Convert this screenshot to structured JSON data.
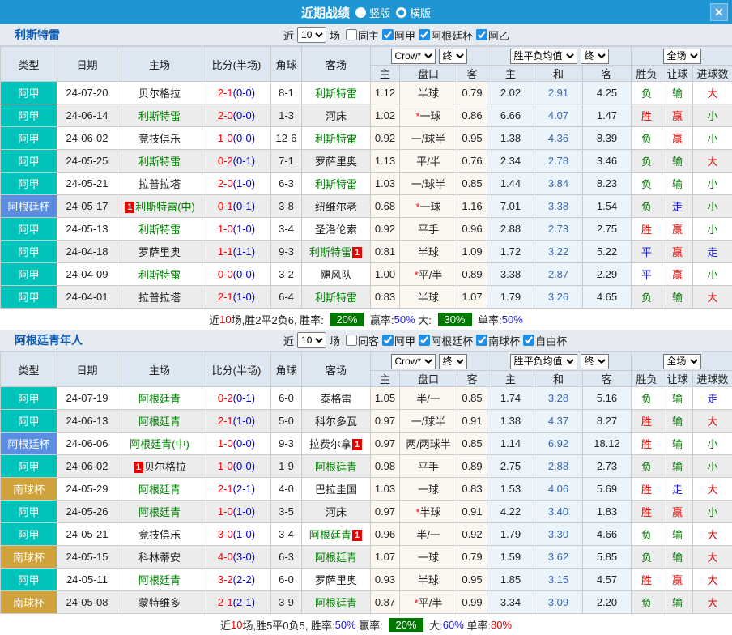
{
  "titlebar": {
    "title": "近期战绩",
    "layout_options": [
      {
        "label": "竖版",
        "selected": true
      },
      {
        "label": "横版",
        "selected": false
      }
    ],
    "close_label": "✕"
  },
  "colors": {
    "league": {
      "阿甲": "#00c3b9",
      "阿根廷杯": "#5b8de0",
      "南球杯": "#cfa23c"
    },
    "result": {
      "胜": "#e60000",
      "平": "#1a1ae6",
      "负": "#007a00",
      "赢": "#e60000",
      "输": "#007a00",
      "走": "#1a1ae6",
      "大": "#e60000",
      "小": "#007a00"
    },
    "titlebar_blue": "#1f96d3",
    "team_green": "#008000",
    "score_main_red": "#ff0000",
    "score_half_blue": "#0000dd",
    "summary_badge_green": "#007800"
  },
  "table": {
    "filter_prefix": "近",
    "filter_suffix": "场",
    "select_value": "10",
    "columns_left": [
      "类型",
      "日期",
      "主场",
      "比分(半场)",
      "角球",
      "客场"
    ],
    "odds_group": {
      "select1": "Crow*",
      "select2": "终",
      "cols": [
        "主",
        "盘口",
        "客"
      ]
    },
    "avg_group": {
      "select1": "胜平负均值",
      "select2": "终",
      "cols": [
        "主",
        "和",
        "客"
      ]
    },
    "scope_group": {
      "select": "全场",
      "cols": [
        "胜负",
        "让球",
        "进球数"
      ]
    }
  },
  "sections": [
    {
      "team": "利斯特雷",
      "same_label": "同主",
      "same_checked": false,
      "league_filters": [
        "阿甲",
        "阿根廷杯",
        "阿乙"
      ],
      "rows": [
        {
          "league": "阿甲",
          "date": "24-07-20",
          "home": {
            "name": "贝尔格拉",
            "green": false,
            "badge": null
          },
          "score": "2-1",
          "half": "(0-0)",
          "corners": "8-1",
          "away": {
            "name": "利斯特雷",
            "green": true,
            "badge": null
          },
          "odds": {
            "home": "1.12",
            "handicap": "半球",
            "star": false,
            "away": "0.79"
          },
          "avg": {
            "home": "2.02",
            "draw": "2.91",
            "away": "4.25"
          },
          "results": [
            "负",
            "输",
            "大"
          ]
        },
        {
          "league": "阿甲",
          "date": "24-06-14",
          "home": {
            "name": "利斯特雷",
            "green": true,
            "badge": null
          },
          "score": "2-0",
          "half": "(0-0)",
          "corners": "1-3",
          "away": {
            "name": "河床",
            "green": false,
            "badge": null
          },
          "odds": {
            "home": "1.02",
            "handicap": "一球",
            "star": true,
            "away": "0.86"
          },
          "avg": {
            "home": "6.66",
            "draw": "4.07",
            "away": "1.47"
          },
          "results": [
            "胜",
            "赢",
            "小"
          ]
        },
        {
          "league": "阿甲",
          "date": "24-06-02",
          "home": {
            "name": "竞技俱乐",
            "green": false,
            "badge": null
          },
          "score": "1-0",
          "half": "(0-0)",
          "corners": "12-6",
          "away": {
            "name": "利斯特雷",
            "green": true,
            "badge": null
          },
          "odds": {
            "home": "0.92",
            "handicap": "一/球半",
            "star": false,
            "away": "0.95"
          },
          "avg": {
            "home": "1.38",
            "draw": "4.36",
            "away": "8.39"
          },
          "results": [
            "负",
            "赢",
            "小"
          ]
        },
        {
          "league": "阿甲",
          "date": "24-05-25",
          "home": {
            "name": "利斯特雷",
            "green": true,
            "badge": null
          },
          "score": "0-2",
          "half": "(0-1)",
          "corners": "7-1",
          "away": {
            "name": "罗萨里奥",
            "green": false,
            "badge": null
          },
          "odds": {
            "home": "1.13",
            "handicap": "平/半",
            "star": false,
            "away": "0.76"
          },
          "avg": {
            "home": "2.34",
            "draw": "2.78",
            "away": "3.46"
          },
          "results": [
            "负",
            "输",
            "大"
          ]
        },
        {
          "league": "阿甲",
          "date": "24-05-21",
          "home": {
            "name": "拉普拉塔",
            "green": false,
            "badge": null
          },
          "score": "2-0",
          "half": "(1-0)",
          "corners": "6-3",
          "away": {
            "name": "利斯特雷",
            "green": true,
            "badge": null
          },
          "odds": {
            "home": "1.03",
            "handicap": "一/球半",
            "star": false,
            "away": "0.85"
          },
          "avg": {
            "home": "1.44",
            "draw": "3.84",
            "away": "8.23"
          },
          "results": [
            "负",
            "输",
            "小"
          ]
        },
        {
          "league": "阿根廷杯",
          "date": "24-05-17",
          "home": {
            "name": "利斯特雷(中)",
            "green": true,
            "badge": "1",
            "badge_pos": "before"
          },
          "score": "0-1",
          "half": "(0-1)",
          "corners": "3-8",
          "away": {
            "name": "纽维尔老",
            "green": false,
            "badge": null
          },
          "odds": {
            "home": "0.68",
            "handicap": "一球",
            "star": true,
            "away": "1.16"
          },
          "avg": {
            "home": "7.01",
            "draw": "3.38",
            "away": "1.54"
          },
          "results": [
            "负",
            "走",
            "小"
          ]
        },
        {
          "league": "阿甲",
          "date": "24-05-13",
          "home": {
            "name": "利斯特雷",
            "green": true,
            "badge": null
          },
          "score": "1-0",
          "half": "(1-0)",
          "corners": "3-4",
          "away": {
            "name": "圣洛伦索",
            "green": false,
            "badge": null
          },
          "odds": {
            "home": "0.92",
            "handicap": "平手",
            "star": false,
            "away": "0.96"
          },
          "avg": {
            "home": "2.88",
            "draw": "2.73",
            "away": "2.75"
          },
          "results": [
            "胜",
            "赢",
            "小"
          ]
        },
        {
          "league": "阿甲",
          "date": "24-04-18",
          "home": {
            "name": "罗萨里奥",
            "green": false,
            "badge": null
          },
          "score": "1-1",
          "half": "(1-1)",
          "corners": "9-3",
          "away": {
            "name": "利斯特雷",
            "green": true,
            "badge": "1",
            "badge_pos": "after"
          },
          "odds": {
            "home": "0.81",
            "handicap": "半球",
            "star": false,
            "away": "1.09"
          },
          "avg": {
            "home": "1.72",
            "draw": "3.22",
            "away": "5.22"
          },
          "results": [
            "平",
            "赢",
            "走"
          ]
        },
        {
          "league": "阿甲",
          "date": "24-04-09",
          "home": {
            "name": "利斯特雷",
            "green": true,
            "badge": null
          },
          "score": "0-0",
          "half": "(0-0)",
          "corners": "3-2",
          "away": {
            "name": "飓风队",
            "green": false,
            "badge": null
          },
          "odds": {
            "home": "1.00",
            "handicap": "平/半",
            "star": true,
            "away": "0.89"
          },
          "avg": {
            "home": "3.38",
            "draw": "2.87",
            "away": "2.29"
          },
          "results": [
            "平",
            "赢",
            "小"
          ]
        },
        {
          "league": "阿甲",
          "date": "24-04-01",
          "home": {
            "name": "拉普拉塔",
            "green": false,
            "badge": null
          },
          "score": "2-1",
          "half": "(1-0)",
          "corners": "6-4",
          "away": {
            "name": "利斯特雷",
            "green": true,
            "badge": null
          },
          "odds": {
            "home": "0.83",
            "handicap": "半球",
            "star": false,
            "away": "1.07"
          },
          "avg": {
            "home": "1.79",
            "draw": "3.26",
            "away": "4.65"
          },
          "results": [
            "负",
            "输",
            "大"
          ]
        }
      ],
      "summary": [
        {
          "text": "近",
          "style": "plain"
        },
        {
          "text": "10",
          "style": "red"
        },
        {
          "text": "场,胜2平2负6, 胜率: ",
          "style": "plain"
        },
        {
          "text": "20%",
          "style": "green-badge"
        },
        {
          "text": " 赢率:",
          "style": "plain"
        },
        {
          "text": "50%",
          "style": "blue"
        },
        {
          "text": " 大: ",
          "style": "plain"
        },
        {
          "text": "30%",
          "style": "green-badge"
        },
        {
          "text": " 单率:",
          "style": "plain"
        },
        {
          "text": "50%",
          "style": "blue"
        }
      ]
    },
    {
      "team": "阿根廷青年人",
      "same_label": "同客",
      "same_checked": false,
      "league_filters": [
        "阿甲",
        "阿根廷杯",
        "南球杯",
        "自由杯"
      ],
      "rows": [
        {
          "league": "阿甲",
          "date": "24-07-19",
          "home": {
            "name": "阿根廷青",
            "green": true,
            "badge": null
          },
          "score": "0-2",
          "half": "(0-1)",
          "corners": "6-0",
          "away": {
            "name": "泰格雷",
            "green": false,
            "badge": null
          },
          "odds": {
            "home": "1.05",
            "handicap": "半/一",
            "star": false,
            "away": "0.85"
          },
          "avg": {
            "home": "1.74",
            "draw": "3.28",
            "away": "5.16"
          },
          "results": [
            "负",
            "输",
            "走"
          ]
        },
        {
          "league": "阿甲",
          "date": "24-06-13",
          "home": {
            "name": "阿根廷青",
            "green": true,
            "badge": null
          },
          "score": "2-1",
          "half": "(1-0)",
          "corners": "5-0",
          "away": {
            "name": "科尔多瓦",
            "green": false,
            "badge": null
          },
          "odds": {
            "home": "0.97",
            "handicap": "一/球半",
            "star": false,
            "away": "0.91"
          },
          "avg": {
            "home": "1.38",
            "draw": "4.37",
            "away": "8.27"
          },
          "results": [
            "胜",
            "输",
            "大"
          ]
        },
        {
          "league": "阿根廷杯",
          "date": "24-06-06",
          "home": {
            "name": "阿根廷青(中)",
            "green": true,
            "badge": null
          },
          "score": "1-0",
          "half": "(0-0)",
          "corners": "9-3",
          "away": {
            "name": "拉费尔拿",
            "green": false,
            "badge": "1",
            "badge_pos": "after"
          },
          "odds": {
            "home": "0.97",
            "handicap": "两/两球半",
            "star": false,
            "away": "0.85"
          },
          "avg": {
            "home": "1.14",
            "draw": "6.92",
            "away": "18.12"
          },
          "results": [
            "胜",
            "输",
            "小"
          ]
        },
        {
          "league": "阿甲",
          "date": "24-06-02",
          "home": {
            "name": "贝尔格拉",
            "green": false,
            "badge": "1",
            "badge_pos": "before"
          },
          "score": "1-0",
          "half": "(0-0)",
          "corners": "1-9",
          "away": {
            "name": "阿根廷青",
            "green": true,
            "badge": null
          },
          "odds": {
            "home": "0.98",
            "handicap": "平手",
            "star": false,
            "away": "0.89"
          },
          "avg": {
            "home": "2.75",
            "draw": "2.88",
            "away": "2.73"
          },
          "results": [
            "负",
            "输",
            "小"
          ]
        },
        {
          "league": "南球杯",
          "date": "24-05-29",
          "home": {
            "name": "阿根廷青",
            "green": true,
            "badge": null
          },
          "score": "2-1",
          "half": "(2-1)",
          "corners": "4-0",
          "away": {
            "name": "巴拉圭国",
            "green": false,
            "badge": null
          },
          "odds": {
            "home": "1.03",
            "handicap": "一球",
            "star": false,
            "away": "0.83"
          },
          "avg": {
            "home": "1.53",
            "draw": "4.06",
            "away": "5.69"
          },
          "results": [
            "胜",
            "走",
            "大"
          ]
        },
        {
          "league": "阿甲",
          "date": "24-05-26",
          "home": {
            "name": "阿根廷青",
            "green": true,
            "badge": null
          },
          "score": "1-0",
          "half": "(1-0)",
          "corners": "3-5",
          "away": {
            "name": "河床",
            "green": false,
            "badge": null
          },
          "odds": {
            "home": "0.97",
            "handicap": "半球",
            "star": true,
            "away": "0.91"
          },
          "avg": {
            "home": "4.22",
            "draw": "3.40",
            "away": "1.83"
          },
          "results": [
            "胜",
            "赢",
            "小"
          ]
        },
        {
          "league": "阿甲",
          "date": "24-05-21",
          "home": {
            "name": "竞技俱乐",
            "green": false,
            "badge": null
          },
          "score": "3-0",
          "half": "(1-0)",
          "corners": "3-4",
          "away": {
            "name": "阿根廷青",
            "green": true,
            "badge": "1",
            "badge_pos": "after"
          },
          "odds": {
            "home": "0.96",
            "handicap": "半/一",
            "star": false,
            "away": "0.92"
          },
          "avg": {
            "home": "1.79",
            "draw": "3.30",
            "away": "4.66"
          },
          "results": [
            "负",
            "输",
            "大"
          ]
        },
        {
          "league": "南球杯",
          "date": "24-05-15",
          "home": {
            "name": "科林蒂安",
            "green": false,
            "badge": null
          },
          "score": "4-0",
          "half": "(3-0)",
          "corners": "6-3",
          "away": {
            "name": "阿根廷青",
            "green": true,
            "badge": null
          },
          "odds": {
            "home": "1.07",
            "handicap": "一球",
            "star": false,
            "away": "0.79"
          },
          "avg": {
            "home": "1.59",
            "draw": "3.62",
            "away": "5.85"
          },
          "results": [
            "负",
            "输",
            "大"
          ]
        },
        {
          "league": "阿甲",
          "date": "24-05-11",
          "home": {
            "name": "阿根廷青",
            "green": true,
            "badge": null
          },
          "score": "3-2",
          "half": "(2-2)",
          "corners": "6-0",
          "away": {
            "name": "罗萨里奥",
            "green": false,
            "badge": null
          },
          "odds": {
            "home": "0.93",
            "handicap": "半球",
            "star": false,
            "away": "0.95"
          },
          "avg": {
            "home": "1.85",
            "draw": "3.15",
            "away": "4.57"
          },
          "results": [
            "胜",
            "赢",
            "大"
          ]
        },
        {
          "league": "南球杯",
          "date": "24-05-08",
          "home": {
            "name": "蒙特维多",
            "green": false,
            "badge": null
          },
          "score": "2-1",
          "half": "(2-1)",
          "corners": "3-9",
          "away": {
            "name": "阿根廷青",
            "green": true,
            "badge": null
          },
          "odds": {
            "home": "0.87",
            "handicap": "平/半",
            "star": true,
            "away": "0.99"
          },
          "avg": {
            "home": "3.34",
            "draw": "3.09",
            "away": "2.20"
          },
          "results": [
            "负",
            "输",
            "大"
          ]
        }
      ],
      "summary": [
        {
          "text": "近",
          "style": "plain"
        },
        {
          "text": "10",
          "style": "red"
        },
        {
          "text": "场,胜5平0负5, 胜率:",
          "style": "plain"
        },
        {
          "text": "50%",
          "style": "blue"
        },
        {
          "text": " 赢率: ",
          "style": "plain"
        },
        {
          "text": "20%",
          "style": "green-badge"
        },
        {
          "text": " 大:",
          "style": "plain"
        },
        {
          "text": "60%",
          "style": "blue"
        },
        {
          "text": " 单率:",
          "style": "plain"
        },
        {
          "text": "80%",
          "style": "red"
        }
      ]
    }
  ]
}
